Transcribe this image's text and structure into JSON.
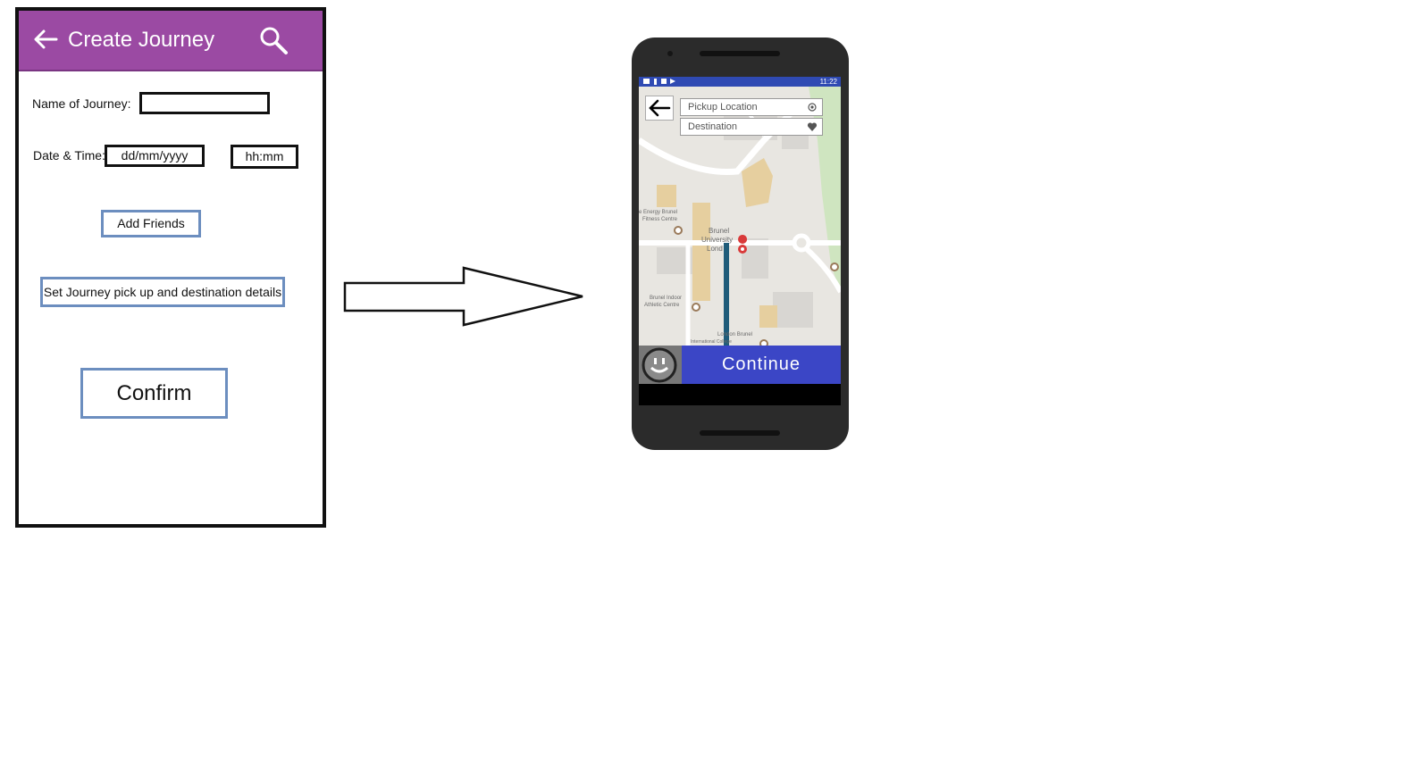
{
  "wireframe": {
    "title": "Create Journey",
    "name_label": "Name of Journey:",
    "name_value": "",
    "datetime_label": "Date & Time:",
    "date_placeholder": "dd/mm/yyyy",
    "time_placeholder": "hh:mm",
    "add_friends_label": "Add Friends",
    "set_details_label": "Set Journey pick up and destination details",
    "confirm_label": "Confirm",
    "header_color": "#9b4aa3",
    "button_border_color": "#6c8ebf"
  },
  "phone": {
    "status_time": "11:22",
    "pickup_placeholder": "Pickup Location",
    "destination_placeholder": "Destination",
    "continue_label": "Continue",
    "map_labels": {
      "energy": "e Energy Brunel",
      "fitness": "Fitness Centre",
      "brunel1": "Brunel",
      "brunel2": "University",
      "brunel3": "Lond",
      "indoor1": "Brunel Indoor",
      "indoor2": "Athletic Centre",
      "college1": "London Brunel",
      "college2": "International College"
    },
    "accent_color": "#3b46c6",
    "statusbar_color": "#2f4ab3"
  }
}
